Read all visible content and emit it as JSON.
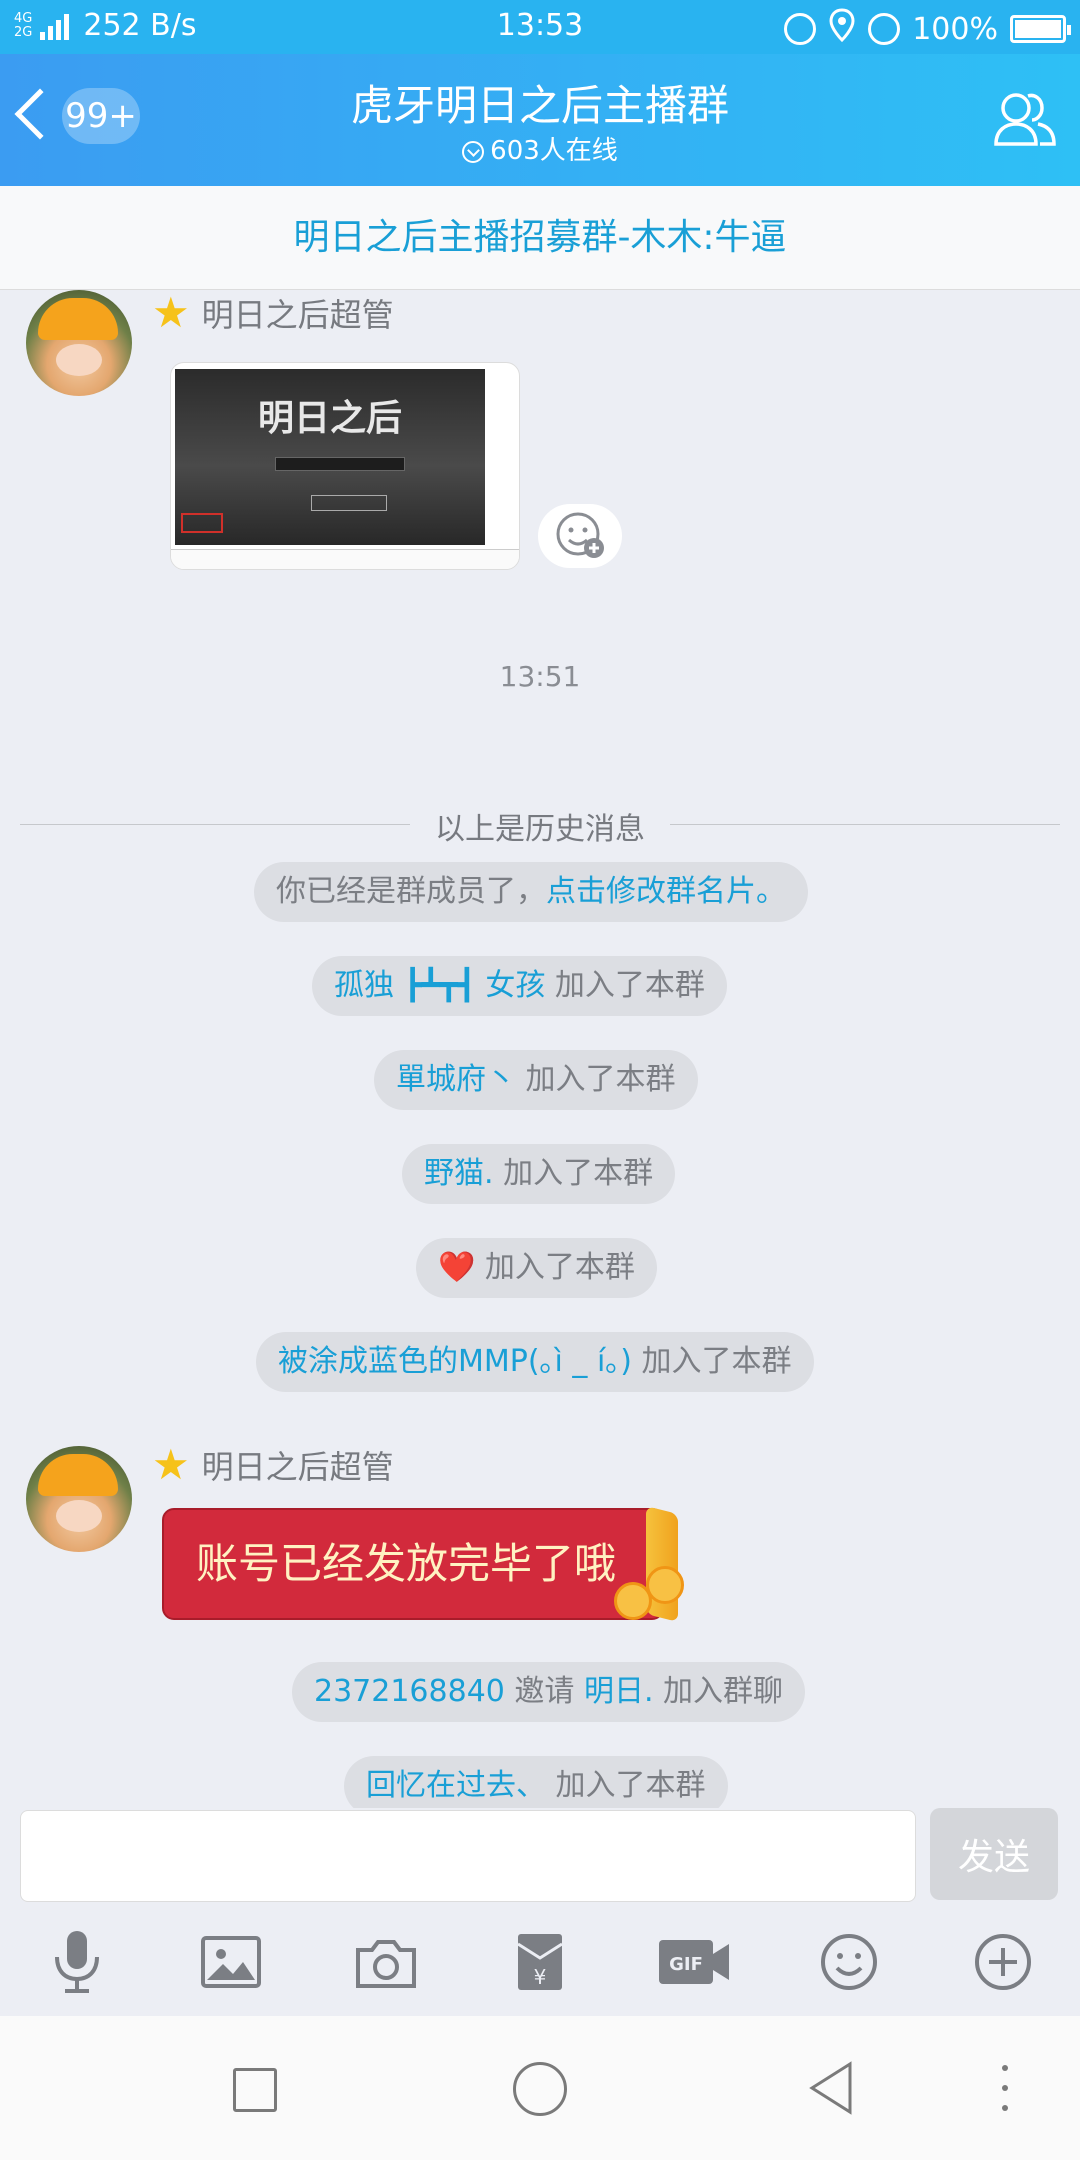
{
  "status_bar": {
    "network_small": "4G\n2G",
    "speed": "252 B/s",
    "time": "13:53",
    "battery": "100%"
  },
  "header": {
    "back_badge": "99+",
    "title": "虎牙明日之后主播群",
    "online": "603人在线"
  },
  "notice": "明日之后主播招募群-木木:牛逼",
  "messages": {
    "sender_1": "明日之后超管",
    "image_logo": "明日之后",
    "time": "13:51",
    "history_label": "以上是历史消息",
    "system": [
      {
        "prefix": "你已经是群成员了，",
        "link": "点击修改群名片。",
        "rest": ""
      },
      {
        "name": "孤独 ┣┻┳┫ 女孩",
        "rest": " 加入了本群"
      },
      {
        "name": "單城府丶",
        "rest": " 加入了本群"
      },
      {
        "name": "野猫.",
        "rest": " 加入了本群"
      },
      {
        "name": "❤️",
        "rest": " 加入了本群"
      },
      {
        "name": "被涂成蓝色的MMP(｡ì _ í｡)",
        "rest": " 加入了本群"
      }
    ],
    "sender_2": "明日之后超管",
    "red_packet": "账号已经发放完毕了哦",
    "invite": {
      "inviter": "2372168840",
      "mid": " 邀请 ",
      "invitee": "明日.",
      "rest": " 加入群聊"
    },
    "last_join": {
      "name": "回忆在过去、",
      "rest": " 加入了本群"
    }
  },
  "input": {
    "placeholder": "",
    "send_label": "发送"
  },
  "colors": {
    "accent": "#199fd6",
    "header_start": "#3b9cf2",
    "header_end": "#2ec0f5",
    "red_packet": "#d22a3c"
  }
}
